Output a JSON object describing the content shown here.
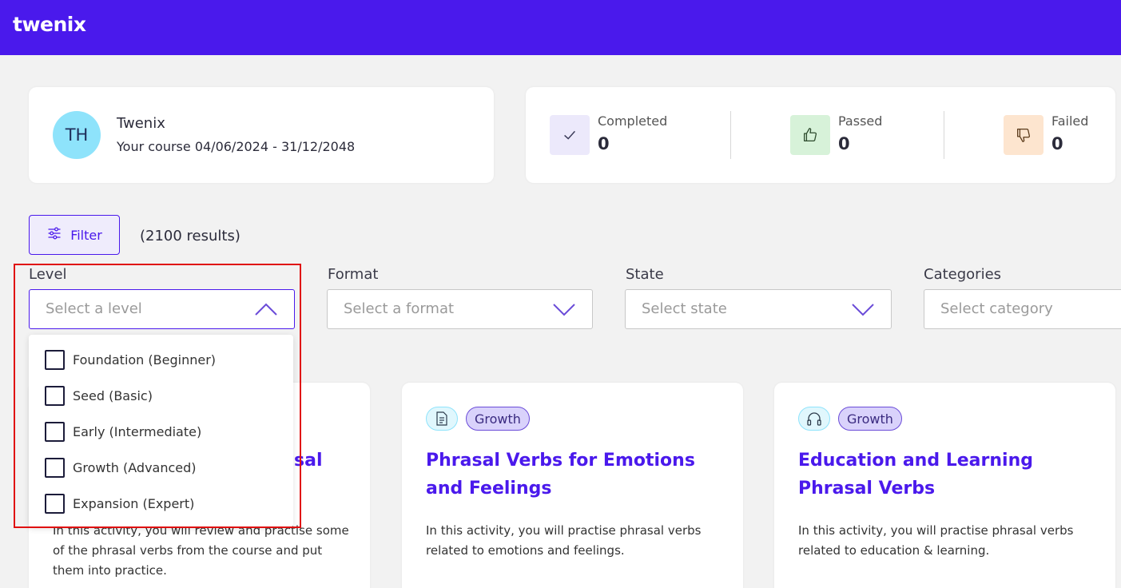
{
  "header": {
    "logo": "twenix",
    "brand_color": "#4a19ec"
  },
  "profile": {
    "avatar_initials": "TH",
    "name": "Twenix",
    "course": "Your course 04/06/2024 - 31/12/2048"
  },
  "stats": [
    {
      "label": "Completed",
      "value": "0",
      "icon": "check-icon",
      "color": "#ece9fb"
    },
    {
      "label": "Passed",
      "value": "0",
      "icon": "thumbs-up-icon",
      "color": "#d7f2d9"
    },
    {
      "label": "Failed",
      "value": "0",
      "icon": "thumbs-down-icon",
      "color": "#fde5cf"
    }
  ],
  "toolbar": {
    "filter_label": "Filter",
    "results": "(2100 results)"
  },
  "filters": {
    "level": {
      "label": "Level",
      "placeholder": "Select a level",
      "open": true
    },
    "format": {
      "label": "Format",
      "placeholder": "Select a format"
    },
    "state": {
      "label": "State",
      "placeholder": "Select state"
    },
    "categories": {
      "label": "Categories",
      "placeholder": "Select category"
    }
  },
  "level_options": [
    "Foundation (Beginner)",
    "Seed (Basic)",
    "Early (Intermediate)",
    "Growth (Advanced)",
    "Expansion (Expert)"
  ],
  "activities": [
    {
      "tag": "",
      "icon": "",
      "title_visible": "sal",
      "description": "In this activity, you will review and practise some of the phrasal verbs from the course and put them into practice."
    },
    {
      "tag": "Growth",
      "icon": "document-icon",
      "title": "Phrasal Verbs for Emotions and Feelings",
      "description": "In this activity, you will practise phrasal verbs related to emotions and feelings."
    },
    {
      "tag": "Growth",
      "icon": "headphones-icon",
      "title": "Education and Learning Phrasal Verbs",
      "description": "In this activity, you will practise phrasal verbs related to education & learning."
    }
  ]
}
